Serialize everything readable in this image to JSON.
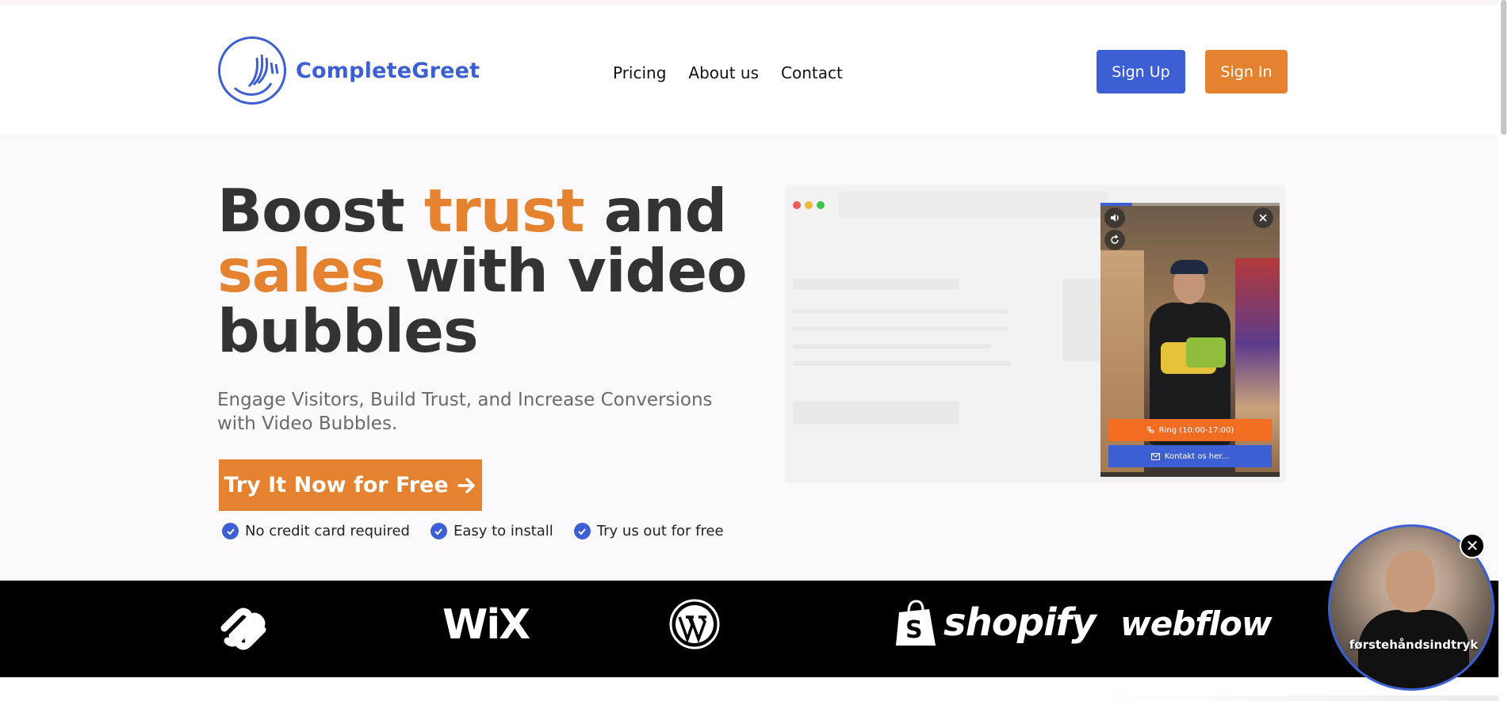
{
  "header": {
    "brand": "CompleteGreet",
    "nav": [
      "Pricing",
      "About us",
      "Contact"
    ],
    "signup_label": "Sign Up",
    "signin_label": "Sign In"
  },
  "hero": {
    "headline_part1": "Boost ",
    "headline_accent1": "trust",
    "headline_part2": " and ",
    "headline_accent2": "sales",
    "headline_part3": " with video bubbles",
    "subhead": "Engage Visitors, Build Trust, and Increase Conversions with Video Bubbles.",
    "cta_label": "Try It Now for Free",
    "checks": [
      "No credit card required",
      "Easy to install",
      "Try us out for free"
    ]
  },
  "demo_widget": {
    "ring_label": "Ring (10:00-17:00)",
    "contact_label": "Kontakt os her..."
  },
  "platform_logos": {
    "wix": "WiX",
    "shopify": "shopify",
    "webflow": "webflow"
  },
  "video_bubble": {
    "caption": "førstehåndsindtryk"
  },
  "colors": {
    "brand_blue": "#3c5fd3",
    "brand_orange": "#e5822f",
    "dark_text": "#333333"
  }
}
